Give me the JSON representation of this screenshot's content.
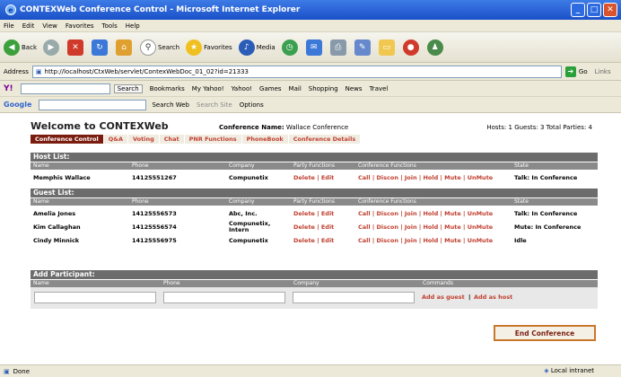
{
  "window": {
    "title": "CONTEXWeb Conference Control - Microsoft Internet Explorer"
  },
  "menu": [
    "File",
    "Edit",
    "View",
    "Favorites",
    "Tools",
    "Help"
  ],
  "toolbar": {
    "back": "Back",
    "search": "Search",
    "favorites": "Favorites",
    "media": "Media"
  },
  "address": {
    "label": "Address",
    "url": "http://localhost/CtxWeb/servlet/ContexWebDoc_01_02?id=21333",
    "go": "Go",
    "links": "Links"
  },
  "yahoo": {
    "search_btn": "Search",
    "bookmarks": "Bookmarks",
    "myyahoo": "My Yahoo!",
    "yahoo": "Yahoo!",
    "games": "Games",
    "mail": "Mail",
    "shopping": "Shopping",
    "news": "News",
    "travel": "Travel"
  },
  "google": {
    "label": "Google",
    "search_web": "Search Web",
    "search_site": "Search Site",
    "options": "Options"
  },
  "page": {
    "welcome": "Welcome to CONTEXWeb",
    "conf_label": "Conference Name:",
    "conf_name": "Wallace Conference",
    "counts": "Hosts: 1  Guests: 3  Total Parties: 4",
    "nav": [
      "Conference Control",
      "Q&A",
      "Voting",
      "Chat",
      "PNR Functions",
      "PhoneBook",
      "Conference Details"
    ],
    "host_title": "Host List:",
    "guest_title": "Guest List:",
    "columns": [
      "Name",
      "Phone",
      "Company",
      "Party Functions",
      "Conference Functions",
      "State"
    ],
    "hosts": [
      {
        "name": "Memphis Wallace",
        "phone": "14125551267",
        "company": "Compunetix",
        "party": "Delete | Edit",
        "conf": "Call | Discon | Join | Hold | Mute | UnMute",
        "state": "Talk: In Conference"
      }
    ],
    "guests": [
      {
        "name": "Amelia Jones",
        "phone": "14125556573",
        "company": "Abc, Inc.",
        "party": "Delete | Edit",
        "conf": "Call | Discon | Join | Hold | Mute | UnMute",
        "state": "Talk: In Conference"
      },
      {
        "name": "Kim Callaghan",
        "phone": "14125556574",
        "company": "Compunetix, Intern",
        "party": "Delete | Edit",
        "conf": "Call | Discon | Join | Hold | Mute | UnMute",
        "state": "Mute: In Conference"
      },
      {
        "name": "Cindy Minnick",
        "phone": "14125556975",
        "company": "Compunetix",
        "party": "Delete | Edit",
        "conf": "Call | Discon | Join | Hold | Mute | UnMute",
        "state": "Idle"
      }
    ],
    "add_title": "Add Participant:",
    "add_columns": [
      "Name",
      "Phone",
      "Company",
      "Commands"
    ],
    "add_guest": "Add as guest",
    "add_host": "Add as host",
    "end_btn": "End Conference"
  },
  "status": {
    "left": "Done",
    "right": "Local intranet"
  }
}
